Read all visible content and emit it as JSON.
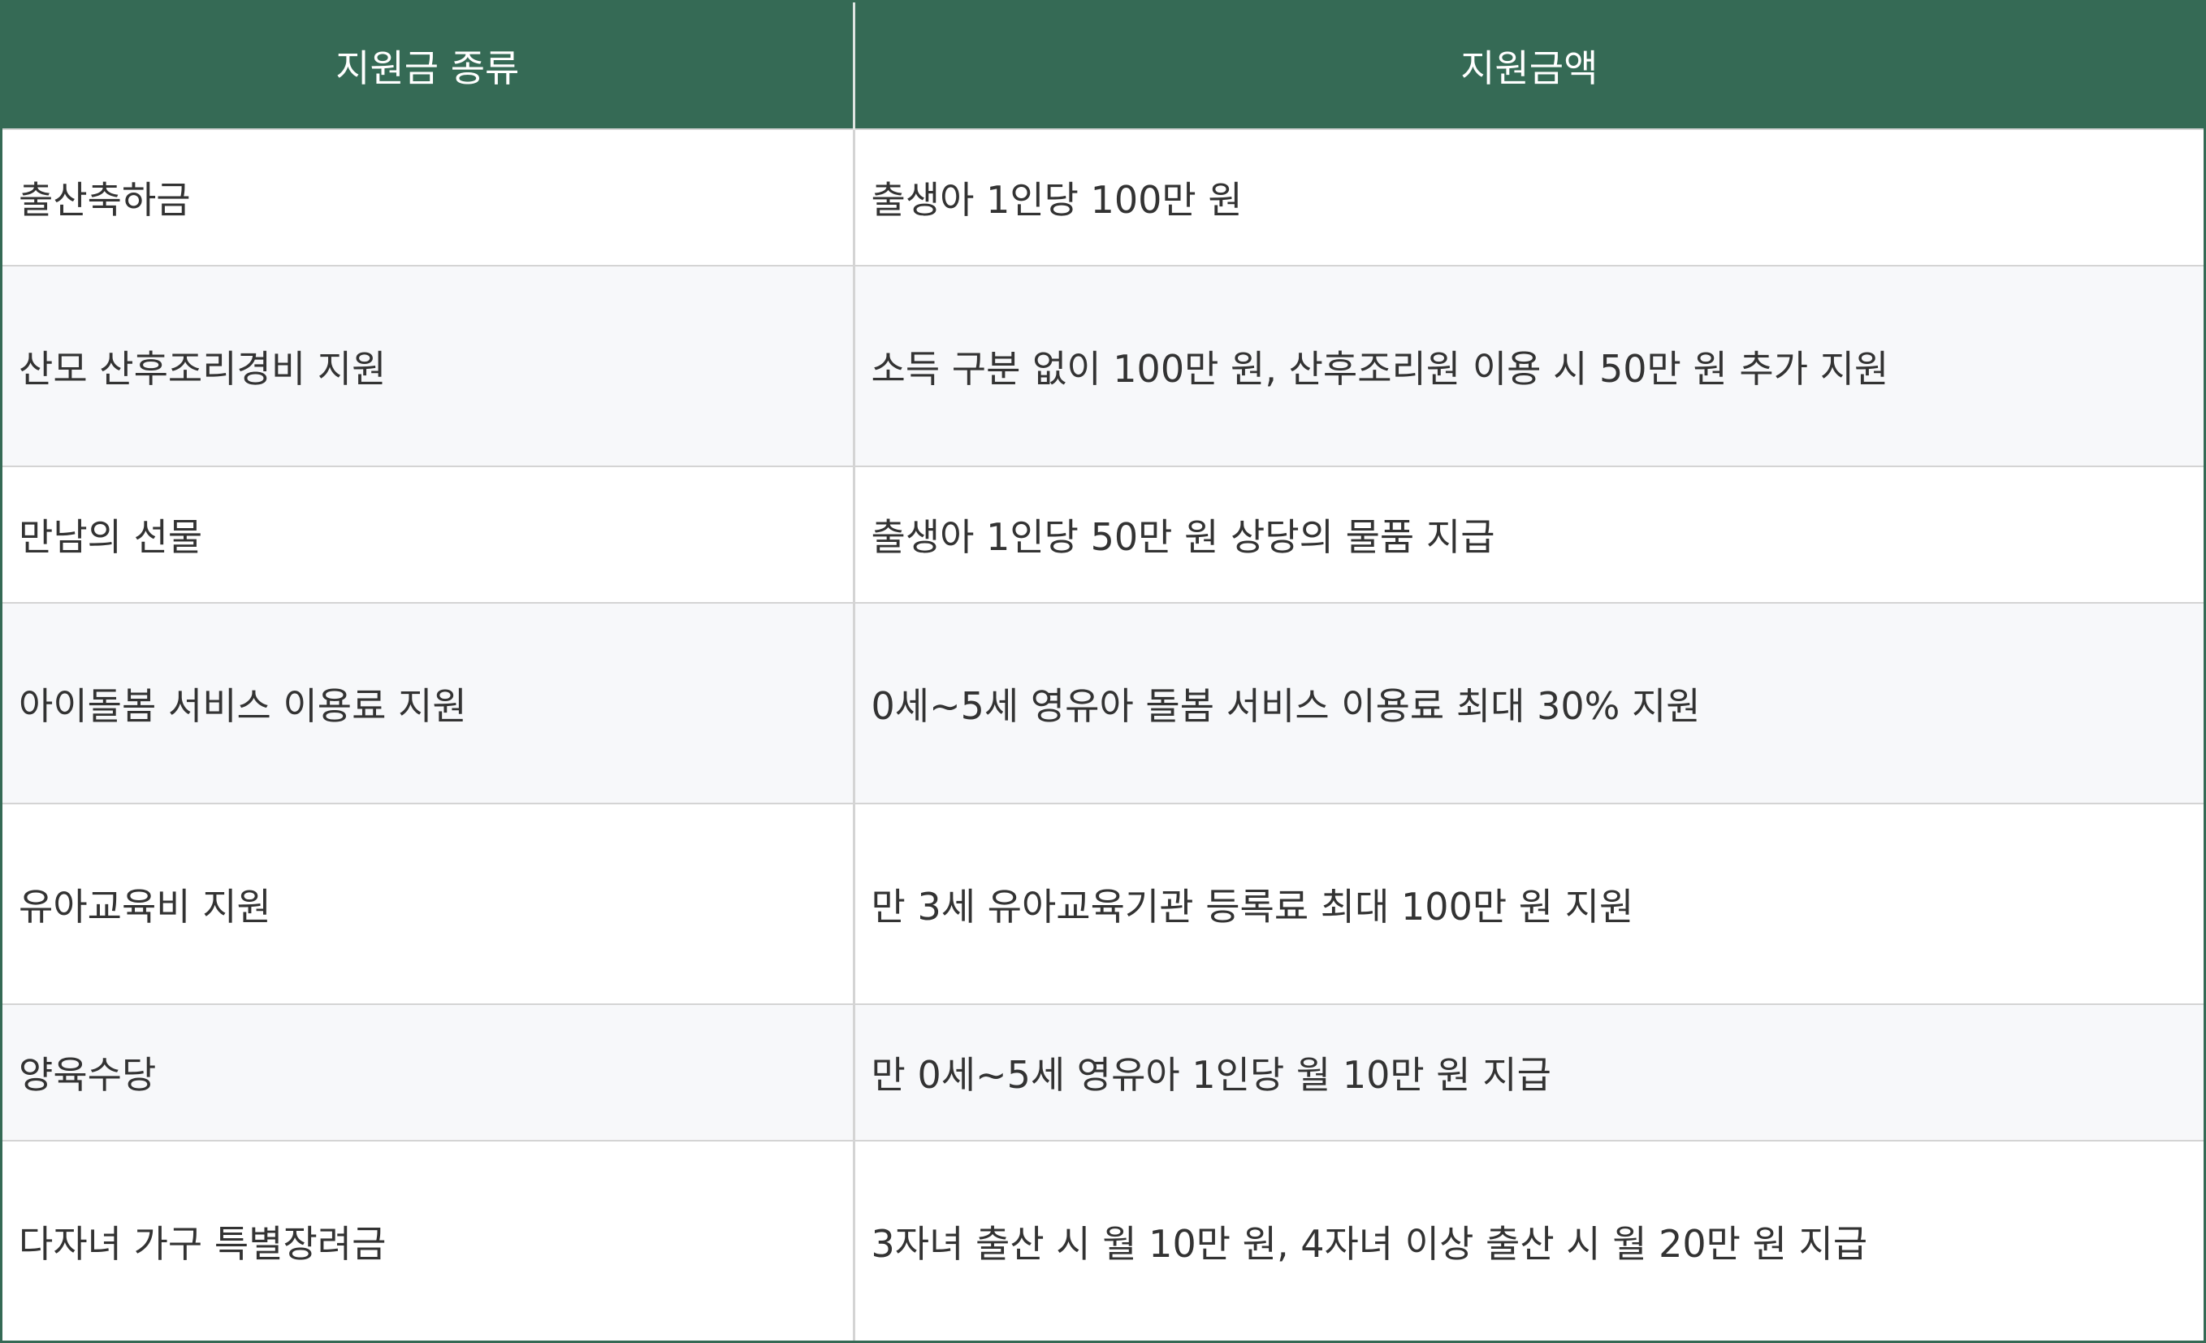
{
  "table": {
    "headers": [
      "지원금 종류",
      "지원금액"
    ],
    "rows": [
      {
        "type": "출산축하금",
        "amount": "출생아 1인당 100만 원"
      },
      {
        "type": "산모 산후조리경비 지원",
        "amount": "소득 구분 없이 100만 원, 산후조리원 이용 시 50만 원 추가 지원"
      },
      {
        "type": "만남의 선물",
        "amount": "출생아 1인당 50만 원 상당의 물품 지급"
      },
      {
        "type": "아이돌봄 서비스 이용료 지원",
        "amount": "0세~5세 영유아 돌봄 서비스 이용료 최대 30% 지원"
      },
      {
        "type": "유아교육비 지원",
        "amount": "만 3세 유아교육기관 등록료 최대 100만 원 지원"
      },
      {
        "type": "양육수당",
        "amount": "만 0세~5세 영유아 1인당 월 10만 원 지급"
      },
      {
        "type": "다자녀 가구 특별장려금",
        "amount": "3자녀 출산 시 월 10만 원, 4자녀 이상 출산 시 월 20만 원 지급"
      }
    ]
  },
  "colors": {
    "header_bg": "#356a55",
    "header_text": "#ffffff",
    "row_alt_bg": "#f7f8fa",
    "cell_text": "#333333"
  }
}
